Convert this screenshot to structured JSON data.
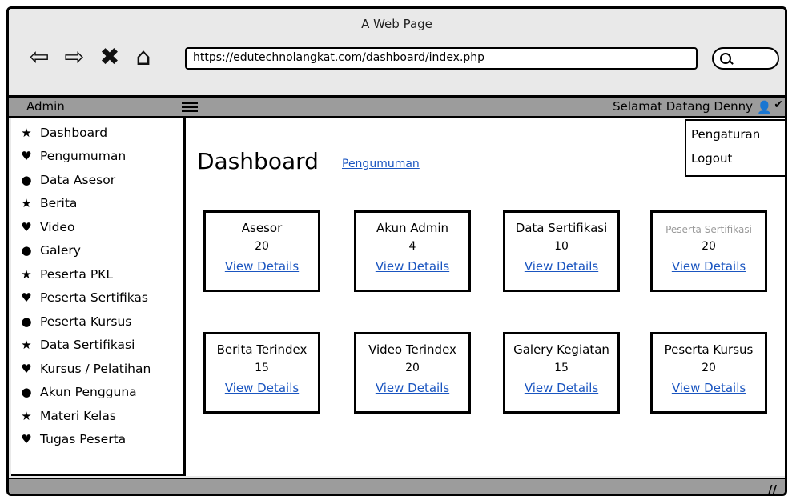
{
  "window": {
    "title": "A Web Page"
  },
  "browser": {
    "url": "https://edutechnolangkat.com/dashboard/index.php",
    "back_icon": "back-arrow-icon",
    "forward_icon": "forward-arrow-icon",
    "close_icon": "close-icon",
    "home_icon": "home-icon",
    "search_icon": "search-icon"
  },
  "header": {
    "brand": "Admin",
    "welcome": "Selamat Datang Denny",
    "menu_icon": "hamburger-icon",
    "user_icon": "user-icon",
    "caret_icon": "chevron-down-icon"
  },
  "user_menu": {
    "items": [
      {
        "label": "Pengaturan"
      },
      {
        "label": "Logout"
      }
    ]
  },
  "sidebar": {
    "items": [
      {
        "label": "Dashboard",
        "icon": "star-icon"
      },
      {
        "label": "Pengumuman",
        "icon": "heart-icon"
      },
      {
        "label": "Data Asesor",
        "icon": "circle-icon"
      },
      {
        "label": "Berita",
        "icon": "star-icon"
      },
      {
        "label": "Video",
        "icon": "heart-icon"
      },
      {
        "label": "Galery",
        "icon": "circle-icon"
      },
      {
        "label": "Peserta PKL",
        "icon": "star-icon"
      },
      {
        "label": "Peserta Sertifikas",
        "icon": "heart-icon"
      },
      {
        "label": "Peserta Kursus",
        "icon": "circle-icon"
      },
      {
        "label": "Data Sertifikasi",
        "icon": "star-icon"
      },
      {
        "label": "Kursus / Pelatihan",
        "icon": "heart-icon"
      },
      {
        "label": "Akun Pengguna",
        "icon": "circle-icon"
      },
      {
        "label": "Materi Kelas",
        "icon": "star-icon"
      },
      {
        "label": "Tugas Peserta",
        "icon": "heart-icon"
      }
    ]
  },
  "main": {
    "title": "Dashboard",
    "link": "Pengumuman",
    "cards": [
      {
        "label": "Asesor",
        "count": "20",
        "link": "View Details"
      },
      {
        "label": "Akun Admin",
        "count": "4",
        "link": "View Details"
      },
      {
        "label": "Data Sertifikasi",
        "count": "10",
        "link": "View Details"
      },
      {
        "label": "Peserta Sertifikasi",
        "count": "20",
        "link": "View Details",
        "faded": true
      },
      {
        "label": "Berita Terindex",
        "count": "15",
        "link": "View Details"
      },
      {
        "label": "Video Terindex",
        "count": "20",
        "link": "View Details"
      },
      {
        "label": "Galery Kegiatan",
        "count": "15",
        "link": "View Details"
      },
      {
        "label": "Peserta Kursus",
        "count": "20",
        "link": "View Details"
      }
    ]
  },
  "colors": {
    "chrome": "#e9e9e9",
    "header_bar": "#9c9c9c",
    "link": "#1a55c0",
    "faded_text": "#9a9a9a"
  }
}
